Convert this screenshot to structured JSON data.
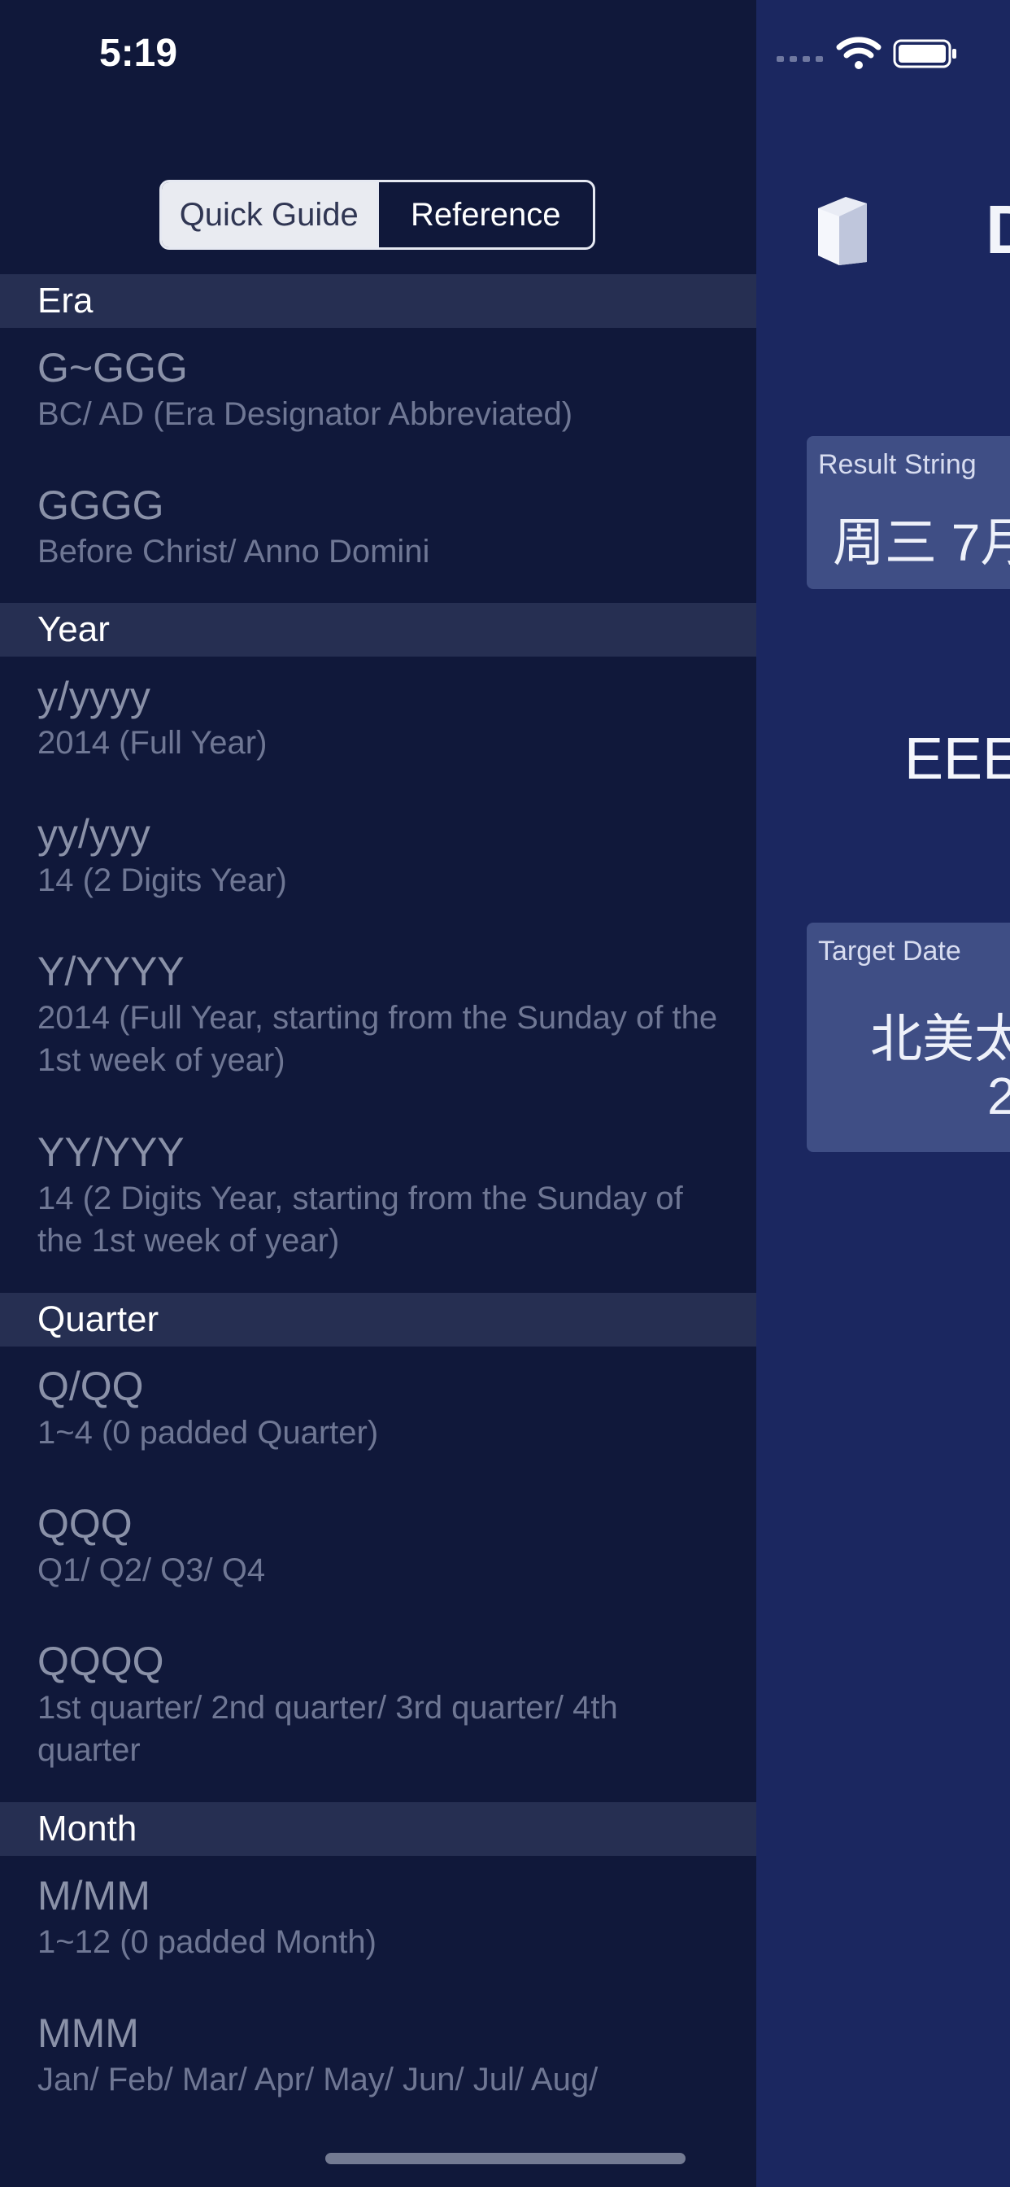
{
  "status_bar": {
    "time": "5:19"
  },
  "segmented": {
    "quick_guide": "Quick Guide",
    "reference": "Reference",
    "selected": "Quick Guide"
  },
  "sections": [
    {
      "title": "Era",
      "items": [
        {
          "code": "G~GGG",
          "desc": "BC/ AD (Era Designator Abbreviated)"
        },
        {
          "code": "GGGG",
          "desc": "Before Christ/ Anno Domini"
        }
      ]
    },
    {
      "title": "Year",
      "items": [
        {
          "code": "y/yyyy",
          "desc": "2014 (Full Year)"
        },
        {
          "code": "yy/yyy",
          "desc": "14 (2 Digits Year)"
        },
        {
          "code": "Y/YYYY",
          "desc": "2014 (Full Year, starting from the Sunday of the 1st week of year)"
        },
        {
          "code": "YY/YYY",
          "desc": "14 (2 Digits Year, starting from the Sunday of the 1st week of year)"
        }
      ]
    },
    {
      "title": "Quarter",
      "items": [
        {
          "code": "Q/QQ",
          "desc": "1~4 (0 padded Quarter)"
        },
        {
          "code": "QQQ",
          "desc": "Q1/ Q2/ Q3/ Q4"
        },
        {
          "code": "QQQQ",
          "desc": "1st quarter/ 2nd quarter/ 3rd quarter/ 4th quarter"
        }
      ]
    },
    {
      "title": "Month",
      "items": [
        {
          "code": "M/MM",
          "desc": "1~12 (0 padded Month)"
        },
        {
          "code": "MMM",
          "desc": "Jan/ Feb/ Mar/ Apr/ May/ Jun/ Jul/ Aug/"
        }
      ]
    }
  ],
  "main": {
    "title_fragment": "D",
    "result_label": "Result String",
    "result_value": "周三 7月",
    "format_fragment": "EEE",
    "target_label": "Target Date",
    "target_value_line1": "北美太",
    "target_value_line2": "2"
  },
  "colors": {
    "drawer_bg": "#10183a",
    "main_bg": "#1b2760",
    "section_header_bg": "#262f52",
    "card_bg": "#3f4e85"
  },
  "icons": [
    "book-icon",
    "signal-icon",
    "wifi-icon",
    "battery-icon"
  ]
}
